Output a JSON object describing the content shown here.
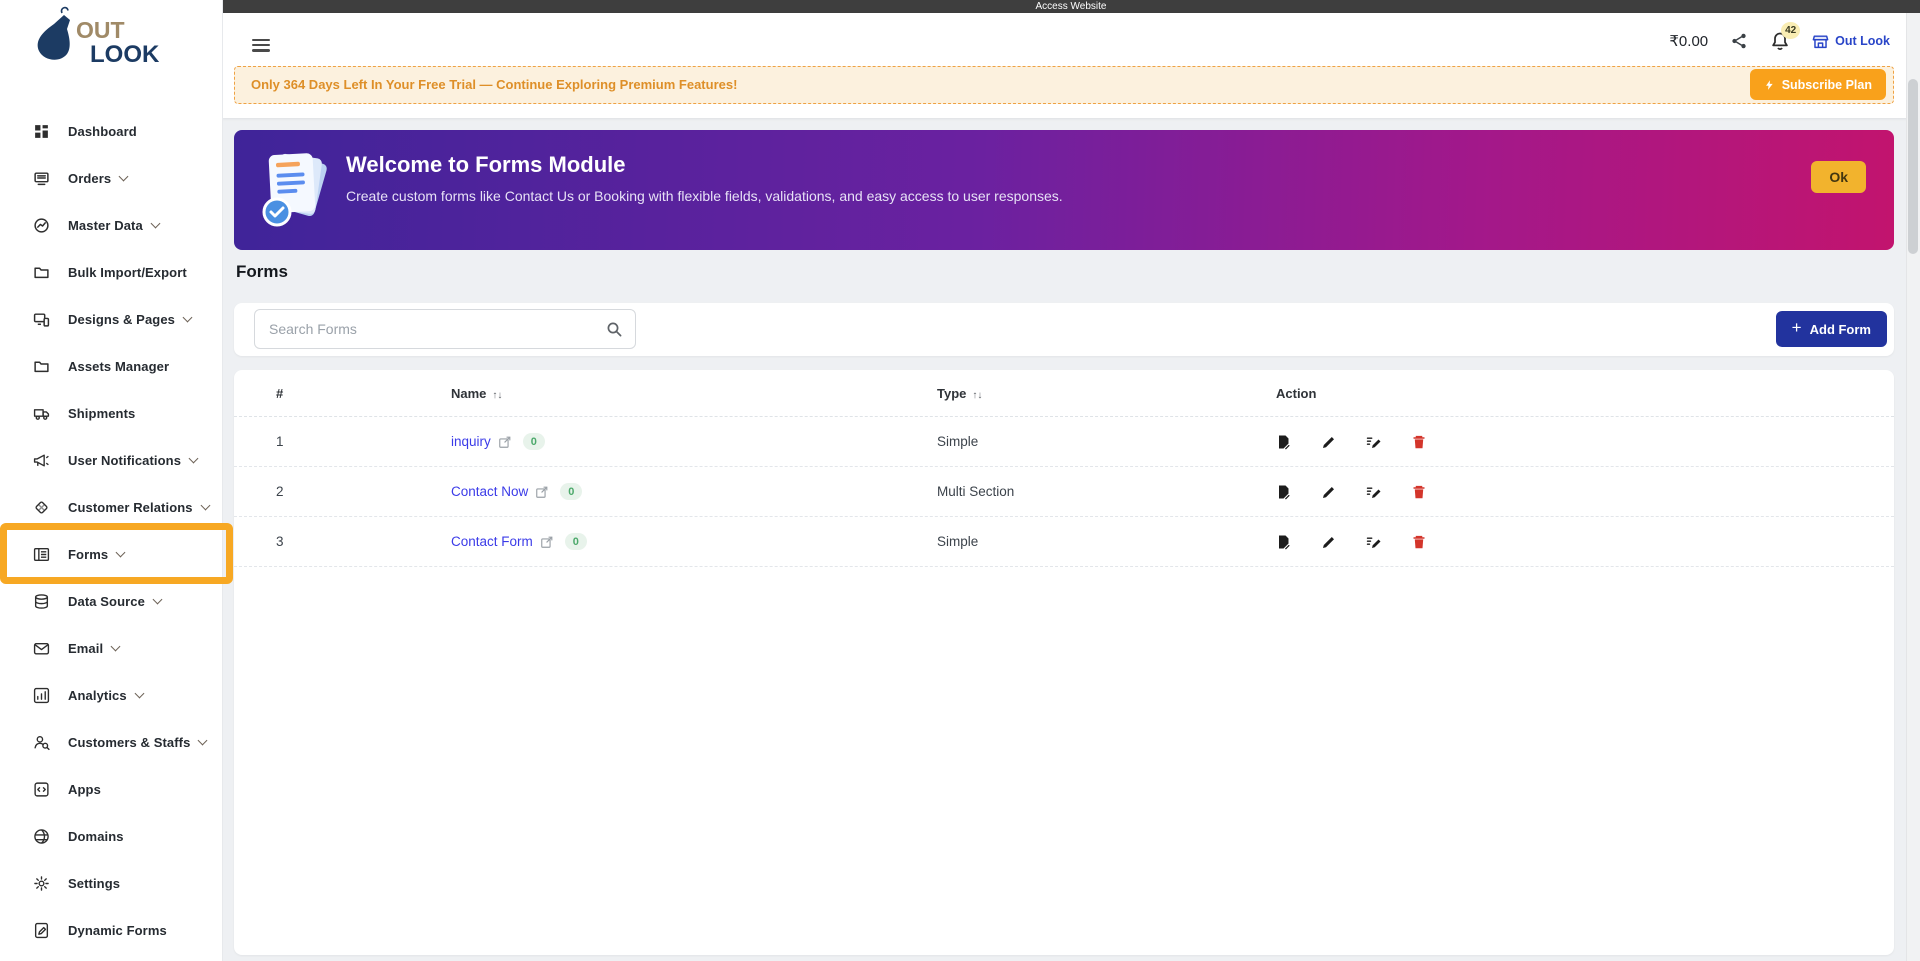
{
  "top_strip": {
    "label": "Access Website"
  },
  "header": {
    "balance": "₹0.00",
    "notification_badge": "42",
    "store_link_label": "Out Look",
    "icons": [
      "menu-icon",
      "share-icon",
      "bell-icon",
      "storefront-icon"
    ]
  },
  "trial_banner": {
    "message": "Only 364 Days Left In Your Free Trial — Continue Exploring Premium Features!",
    "subscribe_button": "Subscribe Plan",
    "subscribe_icon": "lightning-icon"
  },
  "welcome_banner": {
    "title": "Welcome to Forms Module",
    "description": "Create custom forms like Contact Us or Booking with flexible fields, validations, and easy access to user responses.",
    "ok_button": "Ok",
    "icon": "forms-stack-icon"
  },
  "forms_section": {
    "heading": "Forms",
    "search_placeholder": "Search Forms",
    "search_icon": "search-icon",
    "add_button_plus": "+",
    "add_button_label": "Add Form"
  },
  "forms_table": {
    "headers": {
      "index": "#",
      "name": "Name",
      "type": "Type",
      "action": "Action"
    },
    "sort_glyph": "↑↓",
    "action_icons": [
      "document-edit-icon",
      "pencil-icon",
      "pencil-lines-icon",
      "trash-icon"
    ],
    "rows": [
      {
        "index": "1",
        "name": "inquiry",
        "response_count": "0",
        "type": "Simple"
      },
      {
        "index": "2",
        "name": "Contact Now",
        "response_count": "0",
        "type": "Multi Section"
      },
      {
        "index": "3",
        "name": "Contact Form",
        "response_count": "0",
        "type": "Simple"
      }
    ]
  },
  "sidebar": {
    "brand": {
      "word1": "OUT",
      "word2": "LOOK"
    },
    "items": [
      {
        "label": "Dashboard",
        "icon": "dashboard-grid-icon",
        "expandable": false
      },
      {
        "label": "Orders",
        "icon": "orders-icon",
        "expandable": true
      },
      {
        "label": "Master Data",
        "icon": "master-data-icon",
        "expandable": true
      },
      {
        "label": "Bulk Import/Export",
        "icon": "folder-icon",
        "expandable": false
      },
      {
        "label": "Designs & Pages",
        "icon": "designs-pages-icon",
        "expandable": true
      },
      {
        "label": "Assets Manager",
        "icon": "folder-icon",
        "expandable": false
      },
      {
        "label": "Shipments",
        "icon": "truck-icon",
        "expandable": false
      },
      {
        "label": "User Notifications",
        "icon": "megaphone-icon",
        "expandable": true
      },
      {
        "label": "Customer Relations",
        "icon": "handshake-icon",
        "expandable": true
      },
      {
        "label": "Forms",
        "icon": "forms-list-icon",
        "expandable": true,
        "active": true
      },
      {
        "label": "Data Source",
        "icon": "database-icon",
        "expandable": true
      },
      {
        "label": "Email",
        "icon": "email-icon",
        "expandable": true
      },
      {
        "label": "Analytics",
        "icon": "analytics-icon",
        "expandable": true
      },
      {
        "label": "Customers & Staffs",
        "icon": "customers-staffs-icon",
        "expandable": true
      },
      {
        "label": "Apps",
        "icon": "apps-icon",
        "expandable": false
      },
      {
        "label": "Domains",
        "icon": "globe-icon",
        "expandable": false
      },
      {
        "label": "Settings",
        "icon": "gear-icon",
        "expandable": false
      },
      {
        "label": "Dynamic Forms",
        "icon": "dynamic-forms-icon",
        "expandable": false
      }
    ]
  },
  "colors": {
    "highlight_orange": "#f7a823",
    "subscribe_orange": "#f9a11b",
    "trial_bg": "#fcf1de",
    "trial_text": "#de8f28",
    "banner_gradient_start": "#3f2499",
    "banner_gradient_end": "#c2146e",
    "ok_yellow": "#f2b32d",
    "add_form_blue": "#22339e",
    "link_blue": "#3b3be8",
    "badge_green_bg": "#e8f3eb",
    "badge_green_text": "#4ca96b",
    "delete_red": "#d3352b",
    "store_link_blue": "#2945c8",
    "top_strip_bg": "#3e3e3e"
  }
}
